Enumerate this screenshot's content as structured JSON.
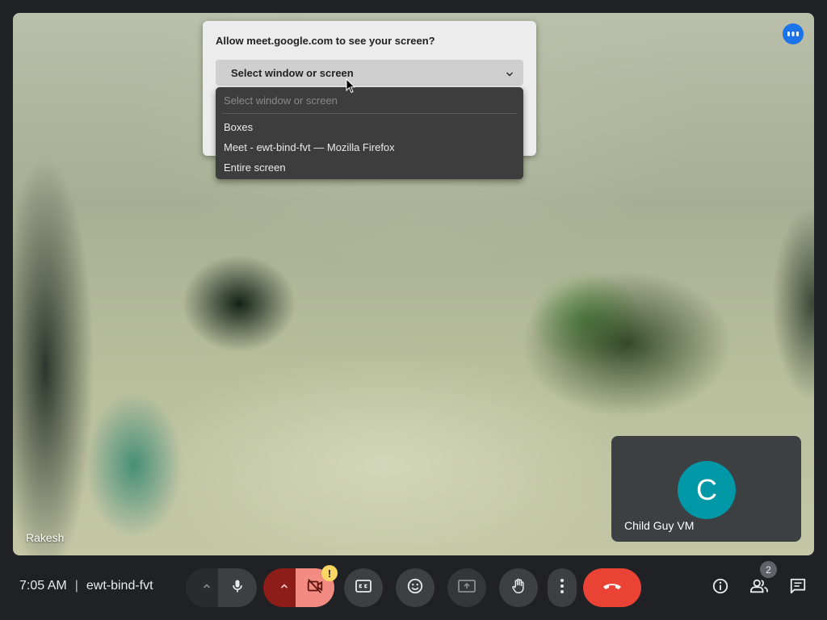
{
  "meeting": {
    "time": "7:05 AM",
    "separator": "|",
    "code": "ewt-bind-fvt"
  },
  "main_video": {
    "participant_name": "Rakesh"
  },
  "self_view": {
    "avatar_letter": "C",
    "name": "Child Guy VM",
    "avatar_color": "#0097a7"
  },
  "share_dialog": {
    "title": "Allow meet.google.com to see your screen?",
    "select_value": "Select window or screen",
    "dropdown": {
      "placeholder": "Select window or screen",
      "options": [
        "Boxes",
        "Meet - ewt-bind-fvt — Mozilla Firefox",
        "Entire screen"
      ]
    }
  },
  "controls": {
    "camera_warning_badge": "!",
    "people_count": "2",
    "end_call_color": "#ea4335",
    "camera_off_color": "#f28b82",
    "accent_color": "#1a73e8"
  },
  "icons": {
    "more_options": "more-dots-icon",
    "audio_options": "chevron-up-icon",
    "mic": "microphone-icon",
    "video_options": "chevron-up-icon",
    "camera": "camera-off-icon",
    "captions": "closed-captions-icon",
    "reactions": "emoji-icon",
    "present": "present-screen-icon",
    "raise_hand": "hand-icon",
    "more": "vertical-dots-icon",
    "end_call": "end-call-icon",
    "info": "info-icon",
    "people": "people-icon",
    "chat": "chat-icon"
  }
}
